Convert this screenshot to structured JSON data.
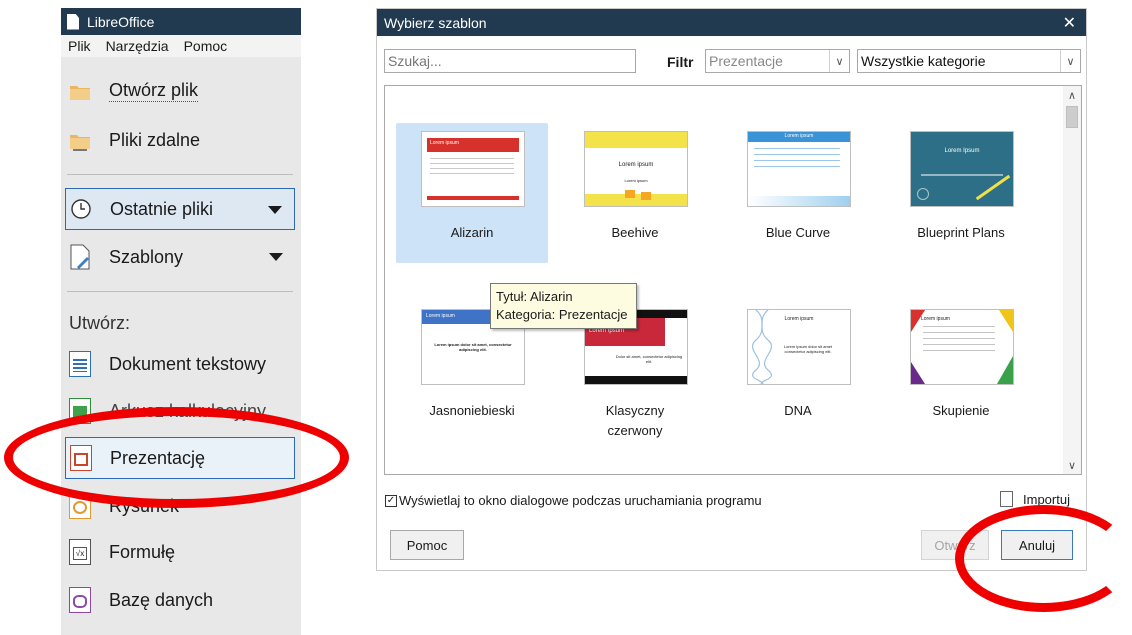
{
  "start_center": {
    "title": "LibreOffice",
    "menu": [
      "Plik",
      "Narzędzia",
      "Pomoc"
    ],
    "open_file": "Otwórz plik",
    "remote_files": "Pliki zdalne",
    "recent_files": "Ostatnie pliki",
    "templates": "Szablony",
    "create_label": "Utwórz:",
    "create_items": [
      "Dokument tekstowy",
      "Arkusz kalkulacyjny",
      "Prezentację",
      "Rysunek",
      "Formułę",
      "Bazę danych"
    ]
  },
  "dialog": {
    "title": "Wybierz szablon",
    "close": "✕",
    "search_placeholder": "Szukaj...",
    "filter_label": "Filtr",
    "filter_value": "Prezentacje",
    "category_value": "Wszystkie kategorie",
    "templates": [
      {
        "name": "Alizarin",
        "thumb_title": "Lorem ipsum"
      },
      {
        "name": "Beehive",
        "thumb_title": "Lorem ipsum",
        "thumb_sub": "Lorem ipsum"
      },
      {
        "name": "Blue Curve",
        "thumb_title": "Lorem ipsum"
      },
      {
        "name": "Blueprint Plans",
        "thumb_title": "Lorem Ipsum"
      },
      {
        "name": "Jasnoniebieski",
        "thumb_title": "Lorem ipsum",
        "thumb_text": "Lorem ipsum dolor sit amet, consectetur adipiscing elit."
      },
      {
        "name": "Klasyczny czerwony",
        "thumb_title": "Lorem Ipsum",
        "thumb_text": "Dolor sit amet, consectetur adipiscing elit."
      },
      {
        "name": "DNA",
        "thumb_title": "Lorem ipsum",
        "thumb_text": "Lorem ipsum dolor sit amet consectetur adipiscing elit."
      },
      {
        "name": "Skupienie",
        "thumb_title": "Lorem ipsum"
      }
    ],
    "tooltip": {
      "title": "Tytuł: Alizarin",
      "category": "Kategoria: Prezentacje"
    },
    "show_dialog_checkbox": "Wyświetlaj to okno dialogowe podczas uruchamiania programu",
    "import_label": "Importuj",
    "help_button": "Pomoc",
    "open_button": "Otwórz",
    "cancel_button": "Anuluj"
  },
  "colors": {
    "titlebar": "#213a4f",
    "selection": "#cde3f7",
    "annotation": "#ee0000"
  }
}
